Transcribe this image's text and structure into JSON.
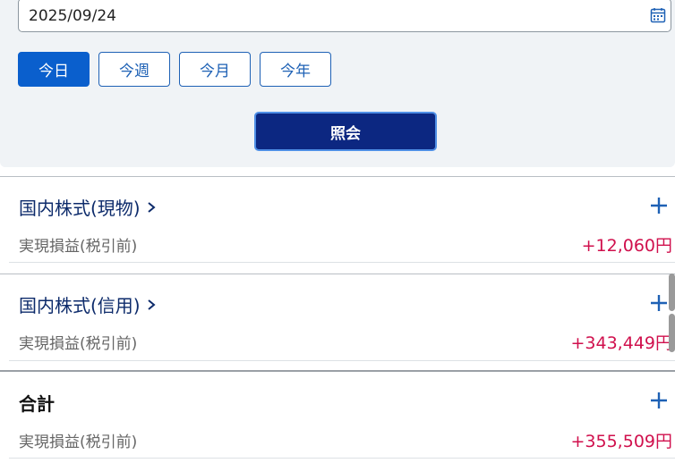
{
  "filter": {
    "date_value": "2025/09/24",
    "period_buttons": [
      {
        "label": "今日",
        "active": true
      },
      {
        "label": "今週",
        "active": false
      },
      {
        "label": "今月",
        "active": false
      },
      {
        "label": "今年",
        "active": false
      }
    ],
    "query_label": "照会"
  },
  "sections": [
    {
      "title": "国内株式(現物)",
      "row_label": "実現損益(税引前)",
      "value": "+12,060円"
    },
    {
      "title": "国内株式(信用)",
      "row_label": "実現損益(税引前)",
      "value": "+343,449円"
    },
    {
      "title": "合計",
      "row_label": "実現損益(税引前)",
      "value": "+355,509円"
    }
  ],
  "colors": {
    "accent": "#0a5fcd",
    "query_button": "#0c2781",
    "profit": "#d0104d",
    "link_title": "#0d2b6b"
  },
  "icons": [
    "calendar-icon",
    "chevron-right-icon",
    "plus-icon"
  ]
}
